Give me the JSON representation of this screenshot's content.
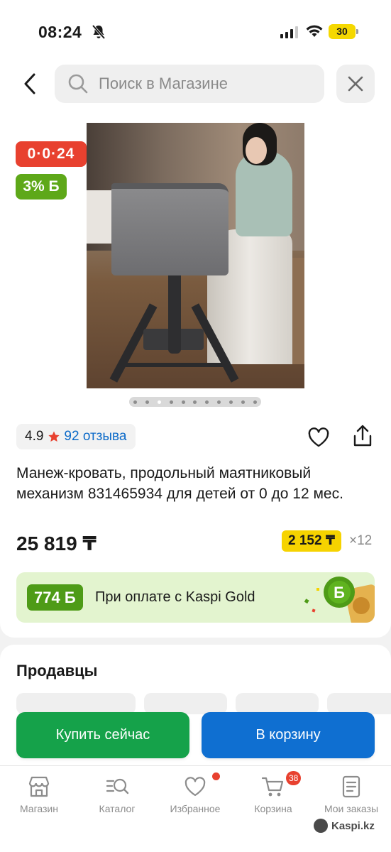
{
  "status_bar": {
    "time": "08:24",
    "battery": "30"
  },
  "search": {
    "placeholder": "Поиск в Магазине"
  },
  "badges": {
    "timer": "0·0·24",
    "bonus": "3% Б"
  },
  "product": {
    "rating": "4.9",
    "reviews": "92 отзыва",
    "title": "Манеж-кровать, продольный маятниковый механизм 831465934 для детей от 0 до 12 мес.",
    "price": "25 819 ₸",
    "installment_amount": "2 152 ₸",
    "installment_multiplier": "×12",
    "image_count": 11,
    "active_image_index": 2
  },
  "kaspi_gold": {
    "amount": "774 Б",
    "text": "При оплате с Kaspi Gold"
  },
  "sellers": {
    "title": "Продавцы"
  },
  "actions": {
    "buy_now": "Купить сейчас",
    "add_to_cart": "В корзину"
  },
  "tabbar": {
    "items": [
      {
        "label": "Магазин",
        "icon": "store-icon"
      },
      {
        "label": "Каталог",
        "icon": "catalog-icon"
      },
      {
        "label": "Избранное",
        "icon": "heart-icon"
      },
      {
        "label": "Корзина",
        "icon": "cart-icon",
        "badge": "38"
      },
      {
        "label": "Мои заказы",
        "icon": "orders-icon"
      }
    ]
  },
  "watermark": "Kaspi.kz",
  "colors": {
    "timer_red": "#e8412f",
    "bonus_green": "#5ea819",
    "installment_yellow": "#f6d300",
    "buy_green": "#15a24a",
    "cart_blue": "#0f6fd1",
    "link_blue": "#0d6bc9"
  }
}
